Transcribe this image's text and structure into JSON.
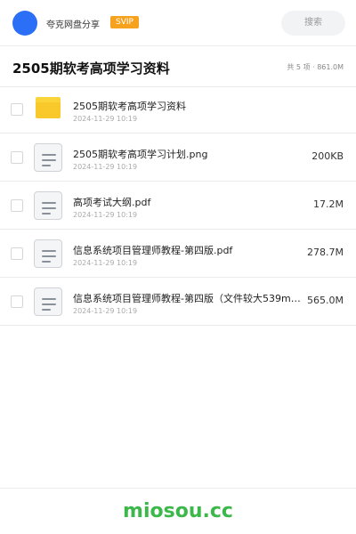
{
  "header": {
    "username": "夸克网盘分享",
    "badge": "SVIP",
    "search_placeholder": "搜索",
    "avatar_color": "#2b6ff7"
  },
  "folder": {
    "title": "2505期软考高项学习资料",
    "summary": "共 5 项 · 861.0M"
  },
  "files": [
    {
      "name": "2505期软考高项学习资料",
      "date": "2024-11-29 10:19",
      "size": "",
      "icon": "folder-icon"
    },
    {
      "name": "2505期软考高项学习计划.png",
      "date": "2024-11-29 10:19",
      "size": "200KB",
      "icon": "document-icon"
    },
    {
      "name": "高项考试大纲.pdf",
      "date": "2024-11-29 10:19",
      "size": "17.2M",
      "icon": "document-icon"
    },
    {
      "name": "信息系统项目管理师教程-第四版.pdf",
      "date": "2024-11-29 10:19",
      "size": "278.7M",
      "icon": "document-icon"
    },
    {
      "name": "信息系统项目管理师教程-第四版（文件较大539m）…",
      "date": "2024-11-29 10:19",
      "size": "565.0M",
      "icon": "document-icon"
    }
  ],
  "footer": {
    "logo": "miosou.cc",
    "logo_color": "#3cb84a"
  }
}
